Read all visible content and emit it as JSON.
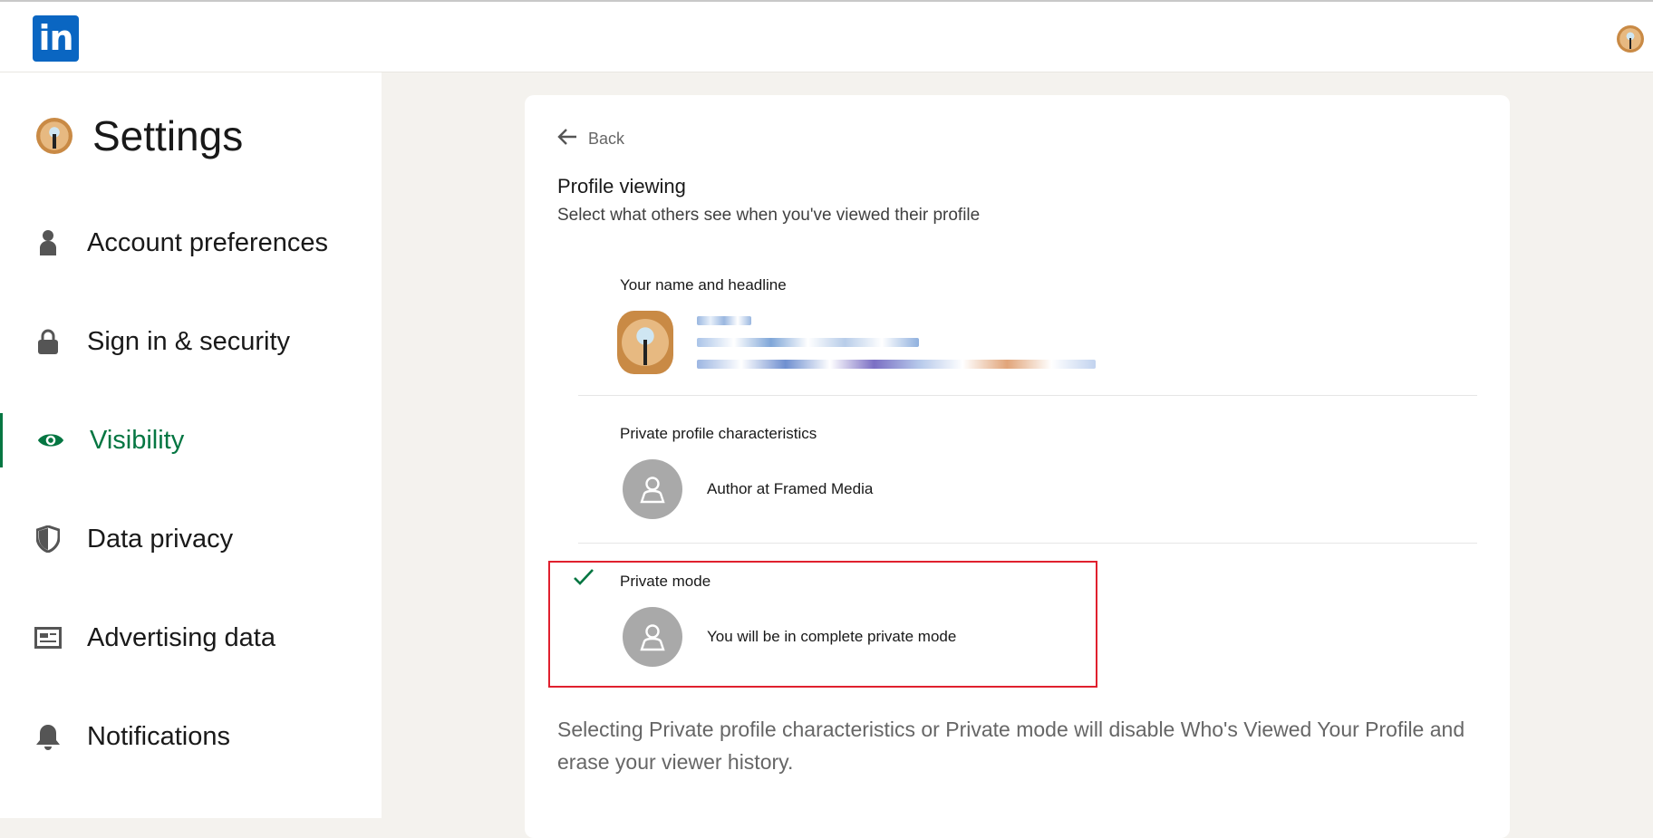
{
  "topbar": {
    "logo_text": "in",
    "logo_color": "#0a66c2"
  },
  "sidebar": {
    "title": "Settings",
    "items": [
      {
        "label": "Account preferences",
        "icon": "person-icon",
        "active": false
      },
      {
        "label": "Sign in & security",
        "icon": "lock-icon",
        "active": false
      },
      {
        "label": "Visibility",
        "icon": "eye-icon",
        "active": true
      },
      {
        "label": "Data privacy",
        "icon": "shield-icon",
        "active": false
      },
      {
        "label": "Advertising data",
        "icon": "ad-icon",
        "active": false
      },
      {
        "label": "Notifications",
        "icon": "bell-icon",
        "active": false
      }
    ],
    "active_color": "#057642"
  },
  "main": {
    "back_label": "Back",
    "section_title": "Profile viewing",
    "section_subtitle": "Select what others see when you've viewed their profile",
    "options": [
      {
        "label": "Your name and headline",
        "selected": false
      },
      {
        "label": "Private profile characteristics",
        "description": "Author at Framed Media",
        "selected": false
      },
      {
        "label": "Private mode",
        "description": "You will be in complete private mode",
        "selected": true
      }
    ],
    "footer_note": "Selecting Private profile characteristics or Private mode will disable Who's Viewed Your Profile and erase your viewer history.",
    "highlight_color": "#e0202e"
  }
}
